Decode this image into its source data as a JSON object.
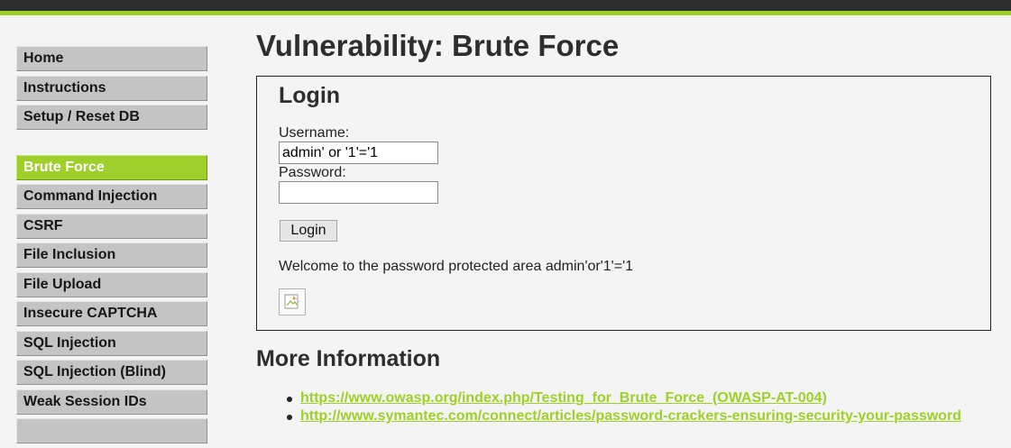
{
  "colors": {
    "accent": "#9ecf2b",
    "topbar": "#2e2e2e",
    "menu_bg": "#c4c4c4",
    "page_bg": "#f4f4f4"
  },
  "menu": {
    "group1": [
      "Home",
      "Instructions",
      "Setup / Reset DB"
    ],
    "group2": [
      "Brute Force",
      "Command Injection",
      "CSRF",
      "File Inclusion",
      "File Upload",
      "Insecure CAPTCHA",
      "SQL Injection",
      "SQL Injection (Blind)",
      "Weak Session IDs"
    ],
    "active": "Brute Force"
  },
  "page": {
    "title": "Vulnerability: Brute Force"
  },
  "login": {
    "title": "Login",
    "username_label": "Username:",
    "username_value": "admin' or '1'='1",
    "password_label": "Password:",
    "password_value": "",
    "button_label": "Login",
    "welcome": "Welcome to the password protected area admin'or'1'='1",
    "image_icon": "broken-image-icon"
  },
  "more_info": {
    "title": "More Information",
    "links": [
      "https://www.owasp.org/index.php/Testing_for_Brute_Force_(OWASP-AT-004)",
      "http://www.symantec.com/connect/articles/password-crackers-ensuring-security-your-password"
    ]
  }
}
